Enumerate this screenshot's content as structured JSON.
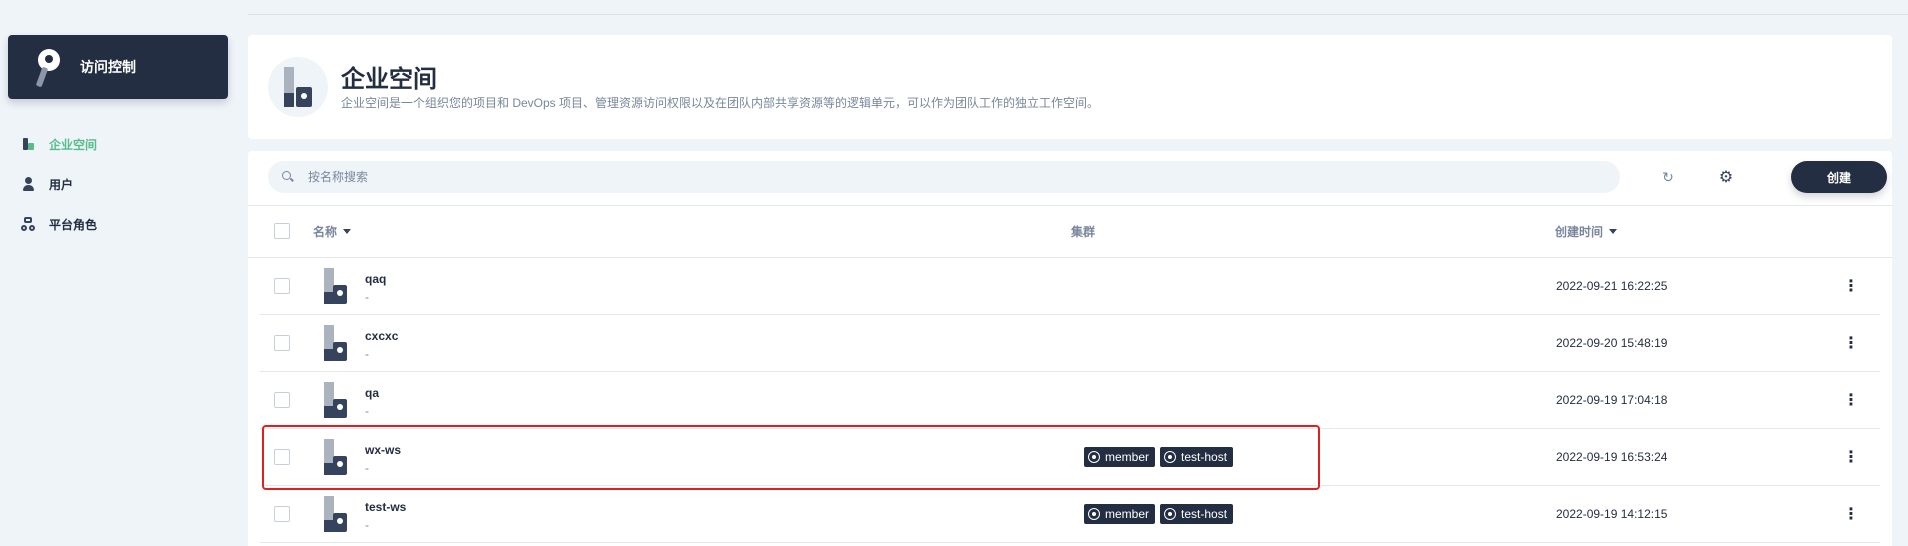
{
  "sidebar": {
    "title": "访问控制",
    "items": [
      {
        "label": "企业空间",
        "icon": "workspace-icon",
        "active": true
      },
      {
        "label": "用户",
        "icon": "user-icon",
        "active": false
      },
      {
        "label": "平台角色",
        "icon": "role-icon",
        "active": false
      }
    ]
  },
  "banner": {
    "title": "企业空间",
    "description": "企业空间是一个组织您的项目和 DevOps 项目、管理资源访问权限以及在团队内部共享资源等的逻辑单元，可以作为团队工作的独立工作空间。"
  },
  "toolbar": {
    "search_placeholder": "按名称搜索",
    "create_label": "创建"
  },
  "table": {
    "headers": {
      "name": "名称",
      "cluster": "集群",
      "created": "创建时间"
    },
    "rows": [
      {
        "name": "qaq",
        "desc": "-",
        "clusters": [],
        "created": "2022-09-21 16:22:25"
      },
      {
        "name": "cxcxc",
        "desc": "-",
        "clusters": [],
        "created": "2022-09-20 15:48:19"
      },
      {
        "name": "qa",
        "desc": "-",
        "clusters": [],
        "created": "2022-09-19 17:04:18"
      },
      {
        "name": "wx-ws",
        "desc": "-",
        "clusters": [
          "member",
          "test-host"
        ],
        "created": "2022-09-19 16:53:24"
      },
      {
        "name": "test-ws",
        "desc": "-",
        "clusters": [
          "member",
          "test-host"
        ],
        "created": "2022-09-19 14:12:15"
      }
    ]
  },
  "colors": {
    "accent": "#55bc8a",
    "dark": "#242e42",
    "highlight": "#e02020"
  }
}
